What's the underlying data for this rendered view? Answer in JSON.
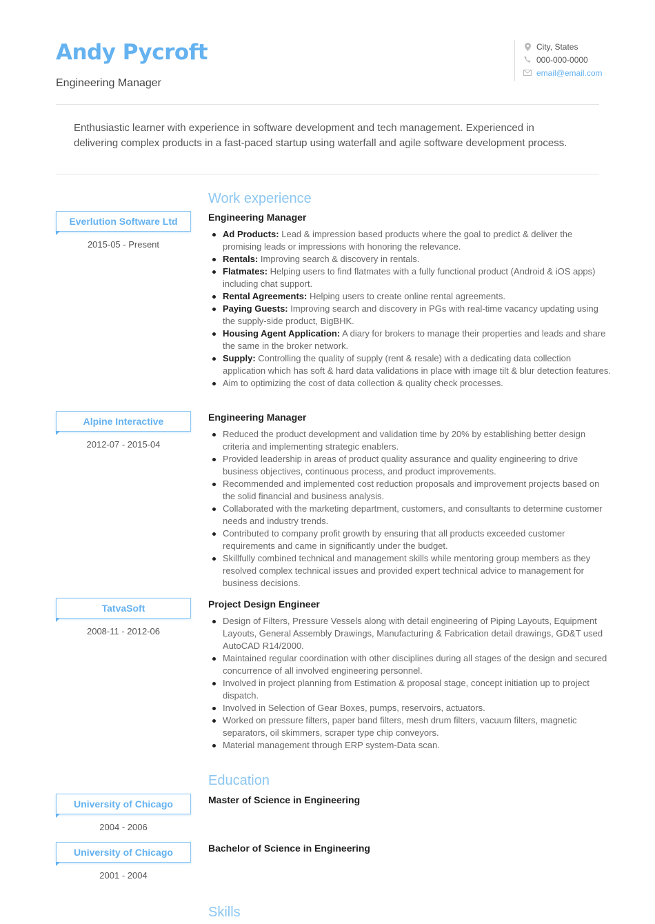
{
  "header": {
    "name": "Andy Pycroft",
    "role": "Engineering Manager",
    "contact": {
      "location": "City, States",
      "phone": "000-000-0000",
      "email": "email@email.com",
      "icons": [
        "location-pin-icon",
        "phone-icon",
        "envelope-icon"
      ]
    }
  },
  "summary": "Enthusiastic learner with experience in software development and tech management. Experienced in delivering complex products in a fast-paced startup using waterfall and agile software development process.",
  "colors": {
    "accent": "#64b2f0",
    "accent_light": "#8cc6f2",
    "text": "#555555",
    "heading": "#222222"
  },
  "work": {
    "title": "Work experience",
    "jobs": [
      {
        "company": "Everlution Software Ltd",
        "dates": "2015-05 - Present",
        "title": "Engineering Manager",
        "bullets": [
          {
            "label": "Ad Products:",
            "text": " Lead & impression based products where the goal to predict & deliver the promising leads or impressions with honoring the relevance."
          },
          {
            "label": "Rentals:",
            "text": " Improving search & discovery in rentals."
          },
          {
            "label": "Flatmates:",
            "text": " Helping users to find flatmates with a fully functional product (Android & iOS apps) including chat support."
          },
          {
            "label": "Rental Agreements:",
            "text": " Helping users to create online rental agreements."
          },
          {
            "label": "Paying Guests:",
            "text": " Improving search and discovery in PGs with real-time vacancy updating using the supply-side product, BigBHK."
          },
          {
            "label": "Housing Agent Application:",
            "text": " A diary for brokers to manage their properties and leads and share the same in the broker network."
          },
          {
            "label": "Supply:",
            "text": " Controlling the quality of supply (rent & resale) with a dedicating data collection application which has soft & hard data validations in place with image tilt & blur detection features."
          },
          {
            "label": "",
            "text": "Aim to optimizing the cost of data collection & quality check processes."
          }
        ]
      },
      {
        "company": "Alpine Interactive",
        "dates": "2012-07 - 2015-04",
        "title": "Engineering Manager",
        "bullets": [
          {
            "label": "",
            "text": "Reduced the product development and validation time by 20% by establishing better design criteria and implementing strategic enablers."
          },
          {
            "label": "",
            "text": "Provided leadership in areas of product quality assurance and quality engineering to drive business objectives, continuous process, and product improvements."
          },
          {
            "label": "",
            "text": "Recommended and implemented cost reduction proposals and improvement projects based on the solid financial and business analysis."
          },
          {
            "label": "",
            "text": "Collaborated with the marketing department, customers, and consultants to determine customer needs and industry trends."
          },
          {
            "label": "",
            "text": "Contributed to company profit growth by ensuring that all products exceeded customer requirements and came in significantly under the budget."
          },
          {
            "label": "",
            "text": "Skillfully combined technical and management skills while mentoring group members as they resolved complex technical issues and provided expert technical advice to management for business decisions."
          }
        ]
      },
      {
        "company": "TatvaSoft",
        "dates": "2008-11 - 2012-06",
        "title": "Project Design Engineer",
        "bullets": [
          {
            "label": "",
            "text": "Design of Filters, Pressure Vessels along with detail engineering of Piping Layouts, Equipment Layouts, General Assembly Drawings, Manufacturing & Fabrication detail drawings, GD&T used AutoCAD R14/2000."
          },
          {
            "label": "",
            "text": "Maintained regular coordination with other disciplines during all stages of the design and secured concurrence of all involved engineering personnel."
          },
          {
            "label": "",
            "text": "Involved in project planning from Estimation & proposal stage, concept initiation up to project dispatch."
          },
          {
            "label": "",
            "text": "Involved in Selection of Gear Boxes, pumps, reservoirs, actuators."
          },
          {
            "label": "",
            "text": "Worked on pressure filters, paper band filters, mesh drum filters, vacuum filters, magnetic separators, oil skimmers, scraper type chip conveyors."
          },
          {
            "label": "",
            "text": "Material management through ERP system-Data scan."
          }
        ]
      }
    ]
  },
  "education": {
    "title": "Education",
    "items": [
      {
        "school": "University of Chicago",
        "dates": "2004 - 2006",
        "degree": "Master of Science in Engineering"
      },
      {
        "school": "University of Chicago",
        "dates": "2001 - 2004",
        "degree": "Bachelor of Science in Engineering"
      }
    ]
  },
  "skills": {
    "title": "Skills"
  }
}
